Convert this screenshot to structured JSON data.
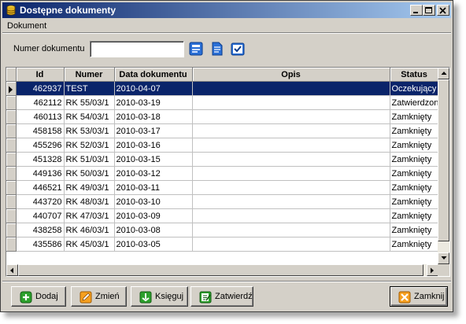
{
  "window": {
    "title": "Dostępne dokumenty"
  },
  "menu": {
    "items": [
      "Dokument"
    ]
  },
  "filter": {
    "label": "Numer dokumentu",
    "value": "",
    "placeholder": ""
  },
  "grid": {
    "columns": [
      "Id",
      "Numer",
      "Data dokumentu",
      "Opis",
      "Status"
    ],
    "rows": [
      {
        "id": "462937",
        "numer": "TEST",
        "data": "2010-04-07",
        "opis": "",
        "status": "Oczekujący"
      },
      {
        "id": "462112",
        "numer": "RK 55/03/1",
        "data": "2010-03-19",
        "opis": "",
        "status": "Zatwierdzony"
      },
      {
        "id": "460113",
        "numer": "RK 54/03/1",
        "data": "2010-03-18",
        "opis": "",
        "status": "Zamknięty"
      },
      {
        "id": "458158",
        "numer": "RK 53/03/1",
        "data": "2010-03-17",
        "opis": "",
        "status": "Zamknięty"
      },
      {
        "id": "455296",
        "numer": "RK 52/03/1",
        "data": "2010-03-16",
        "opis": "",
        "status": "Zamknięty"
      },
      {
        "id": "451328",
        "numer": "RK 51/03/1",
        "data": "2010-03-15",
        "opis": "",
        "status": "Zamknięty"
      },
      {
        "id": "449136",
        "numer": "RK 50/03/1",
        "data": "2010-03-12",
        "opis": "",
        "status": "Zamknięty"
      },
      {
        "id": "446521",
        "numer": "RK 49/03/1",
        "data": "2010-03-11",
        "opis": "",
        "status": "Zamknięty"
      },
      {
        "id": "443720",
        "numer": "RK 48/03/1",
        "data": "2010-03-10",
        "opis": "",
        "status": "Zamknięty"
      },
      {
        "id": "440707",
        "numer": "RK 47/03/1",
        "data": "2010-03-09",
        "opis": "",
        "status": "Zamknięty"
      },
      {
        "id": "438258",
        "numer": "RK 46/03/1",
        "data": "2010-03-08",
        "opis": "",
        "status": "Zamknięty"
      },
      {
        "id": "435586",
        "numer": "RK 45/03/1",
        "data": "2010-03-05",
        "opis": "",
        "status": "Zamknięty"
      }
    ]
  },
  "buttons": {
    "add": "Dodaj",
    "edit": "Zmień",
    "post": "Księguj",
    "approve": "Zatwierdź",
    "close": "Zamknij"
  },
  "colors": {
    "title_start": "#0a246a",
    "title_end": "#a6caf0",
    "selection": "#0a246a",
    "face": "#d4d0c8"
  },
  "icons": {
    "title": "database-icon",
    "search": "search-icon",
    "document": "document-icon",
    "check": "check-icon",
    "add": "plus-icon",
    "edit": "edit-icon",
    "post": "book-icon",
    "approve": "approve-icon",
    "close": "close-icon"
  }
}
